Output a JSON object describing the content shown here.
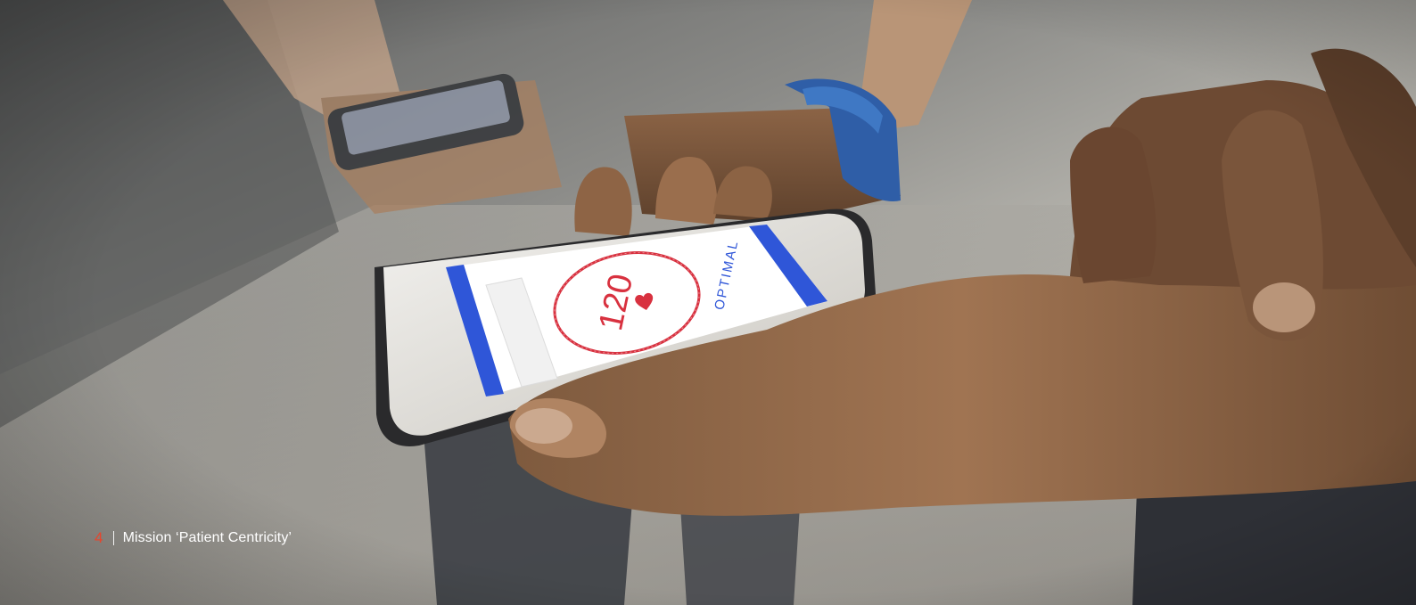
{
  "footer": {
    "page_number": "4",
    "section_title": "Mission ‘Patient Centricity’"
  },
  "screen": {
    "heart_rate": "120",
    "status": "OPTIMAL"
  },
  "colors": {
    "page_number": "#e8452c",
    "footer_text": "#ffffff",
    "app_accent": "#2f56d8",
    "ring": "#d8313f"
  },
  "icons": {
    "heart": "heart-icon"
  }
}
